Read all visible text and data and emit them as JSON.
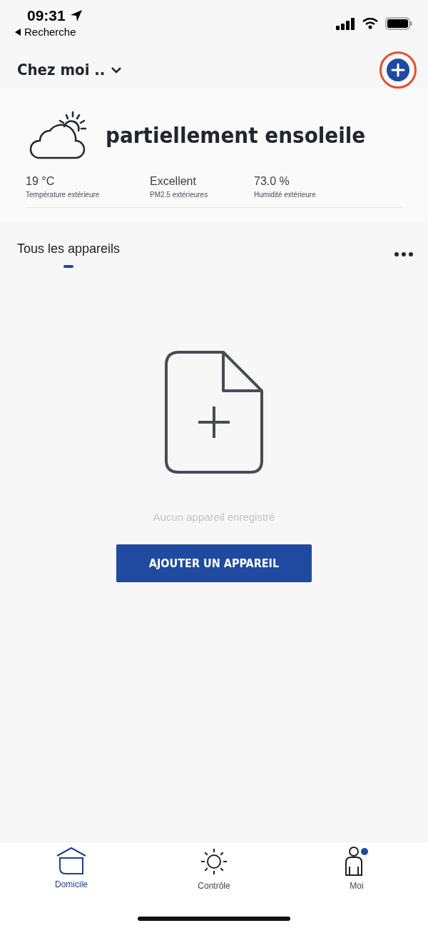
{
  "status_bar": {
    "time": "09:31",
    "back_label": "Recherche"
  },
  "header": {
    "home_name": "Chez moi .."
  },
  "weather": {
    "condition": "partiellement ensoleile",
    "stats": [
      {
        "value": "19 °C",
        "label": "Température extérieure"
      },
      {
        "value": "Excellent",
        "label": "PM2.5 extérieures"
      },
      {
        "value": "73.0 %",
        "label": "Humidité extérieure"
      }
    ]
  },
  "device_tabs": [
    {
      "label": "Tous les appareils",
      "selected": true
    }
  ],
  "empty_state": {
    "message": "Aucun appareil enregistré",
    "button": "AJOUTER UN APPAREIL"
  },
  "tab_bar": [
    {
      "kind": "home",
      "label": "Domicile",
      "selected": true,
      "notification": false
    },
    {
      "kind": "control",
      "label": "Contrôle",
      "selected": false,
      "notification": false
    },
    {
      "kind": "me",
      "label": "Moi",
      "selected": false,
      "notification": true
    }
  ]
}
